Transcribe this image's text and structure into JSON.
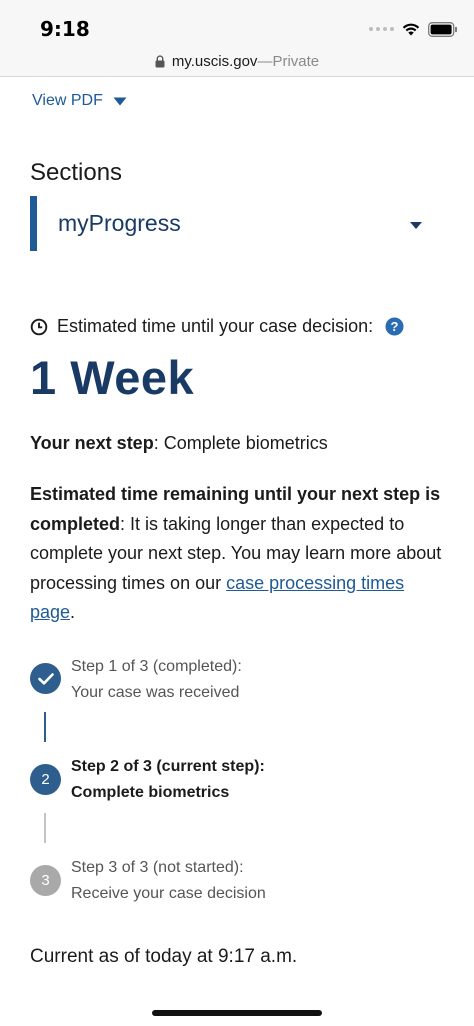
{
  "status_bar": {
    "time": "9:18"
  },
  "browser": {
    "url": "my.uscis.gov",
    "separator": " — ",
    "mode": "Private"
  },
  "view_pdf": {
    "label": "View PDF"
  },
  "sections": {
    "title": "Sections",
    "selected": "myProgress"
  },
  "estimate": {
    "label": "Estimated time until your case decision:",
    "value": "1 Week"
  },
  "next_step": {
    "label": "Your next step",
    "value": ": Complete biometrics"
  },
  "remaining": {
    "label": "Estimated time remaining until your next step is completed",
    "text": ": It is taking longer than expected to complete your next step. You may learn more about processing times on our ",
    "link": "case processing times page",
    "end": "."
  },
  "steps": [
    {
      "line1": "Step 1 of 3 (completed):",
      "line2": "Your case was received",
      "status": "completed",
      "color": "#2e5e8e"
    },
    {
      "number": "2",
      "line1": "Step 2 of 3 (current step):",
      "line2": "Complete biometrics",
      "status": "current",
      "color": "#2e5e8e"
    },
    {
      "number": "3",
      "line1": "Step 3 of 3 (not started):",
      "line2": "Receive your case decision",
      "status": "not-started",
      "color": "#a9a9a9"
    }
  ],
  "footer": {
    "current_as_of": "Current as of today at 9:17 a.m."
  },
  "colors": {
    "primary": "#1e5a96",
    "dark_blue": "#1a3a66",
    "step_blue": "#2e5e8e",
    "step_gray": "#a9a9a9"
  }
}
